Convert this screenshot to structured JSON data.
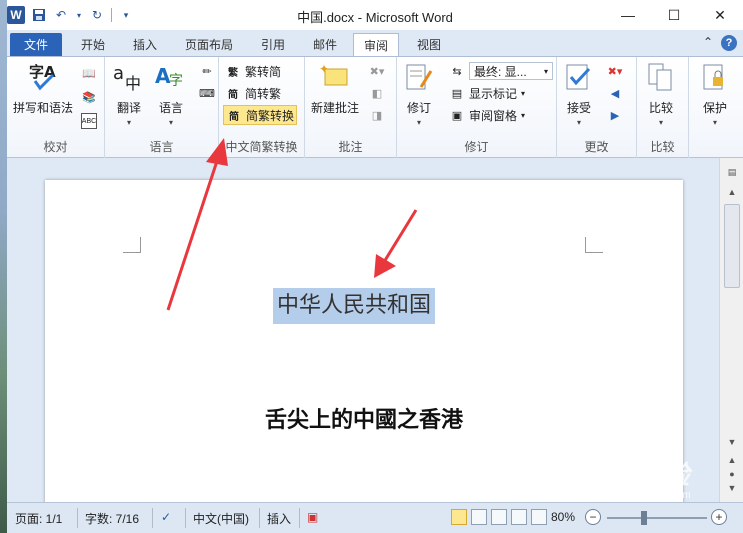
{
  "window": {
    "title": "中国.docx - Microsoft Word",
    "app_icon": "W",
    "controls": [
      "minimize",
      "maximize",
      "close"
    ]
  },
  "tabs": [
    {
      "label": "文件"
    },
    {
      "label": "开始"
    },
    {
      "label": "插入"
    },
    {
      "label": "页面布局"
    },
    {
      "label": "引用"
    },
    {
      "label": "邮件"
    },
    {
      "label": "审阅"
    },
    {
      "label": "视图"
    }
  ],
  "ribbon": {
    "proofing": {
      "spelling": "拼写和语法",
      "label": "校对"
    },
    "language": {
      "translate": "翻译",
      "language": "语言",
      "label": "语言"
    },
    "chinese_conversion": {
      "trad_to_simp": "繁转简",
      "simp_to_trad": "简转繁",
      "conversion": "简繁转换",
      "label": "中文简繁转换"
    },
    "comments": {
      "new_comment": "新建批注",
      "label": "批注"
    },
    "tracking": {
      "track_changes": "修订",
      "markup_dropdown": "最终: 显...",
      "show_markup": "显示标记",
      "reviewing_pane": "审阅窗格",
      "label": "修订"
    },
    "changes": {
      "accept": "接受",
      "label": "更改"
    },
    "compare": {
      "compare": "比较",
      "label": "比较"
    },
    "protect": {
      "protect": "保护"
    }
  },
  "document": {
    "line1": "中华人民共和国",
    "line2": "舌尖上的中國之香港"
  },
  "status": {
    "page": "页面: 1/1",
    "words": "字数: 7/16",
    "language": "中文(中国)",
    "insert": "插入",
    "zoom": "80%"
  },
  "watermark": {
    "text": "Baidu经验",
    "sub": "jingyan.baidu.com"
  },
  "colors": {
    "file_tab": "#2a63b8",
    "highlight": "#b4cdea",
    "arrow": "#e8383d"
  }
}
